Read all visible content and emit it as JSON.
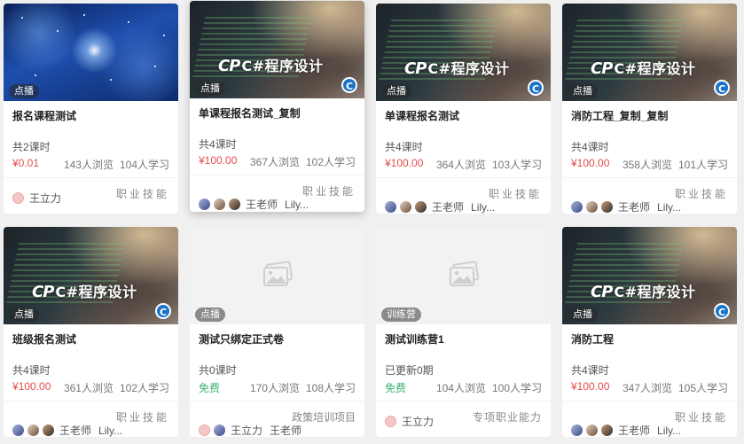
{
  "cards": [
    {
      "tag": "点播",
      "thumb": "galaxy",
      "title": "报名课程测试",
      "lessons": "共2课时",
      "price": "¥0.01",
      "views": "143人浏览",
      "learners": "104人学习",
      "category": "职业技能",
      "teachers": [
        "王立力"
      ]
    },
    {
      "tag": "点播",
      "thumb": "csharp",
      "logo_text": "C#程序设计",
      "title": "单课程报名测试_复制",
      "lessons": "共4课时",
      "price": "¥100.00",
      "views": "367人浏览",
      "learners": "102人学习",
      "category": "职业技能",
      "teachers": [
        "王老师",
        "Lily..."
      ]
    },
    {
      "tag": "点播",
      "thumb": "csharp",
      "logo_text": "C#程序设计",
      "title": "单课程报名测试",
      "lessons": "共4课时",
      "price": "¥100.00",
      "views": "364人浏览",
      "learners": "103人学习",
      "category": "职业技能",
      "teachers": [
        "王老师",
        "Lily..."
      ]
    },
    {
      "tag": "点播",
      "thumb": "csharp",
      "logo_text": "C#程序设计",
      "title": "消防工程_复制_复制",
      "lessons": "共4课时",
      "price": "¥100.00",
      "views": "358人浏览",
      "learners": "101人学习",
      "category": "职业技能",
      "teachers": [
        "王老师",
        "Lily..."
      ]
    },
    {
      "tag": "点播",
      "thumb": "csharp",
      "logo_text": "C#程序设计",
      "title": "班级报名测试",
      "lessons": "共4课时",
      "price": "¥100.00",
      "views": "361人浏览",
      "learners": "102人学习",
      "category": "职业技能",
      "teachers": [
        "王老师",
        "Lily..."
      ]
    },
    {
      "tag": "点播",
      "thumb": "placeholder",
      "title": "测试只绑定正式卷",
      "lessons": "共0课时",
      "price": "免费",
      "views": "170人浏览",
      "learners": "108人学习",
      "category": "政策培训项目",
      "teachers": [
        "王立力",
        "王老师"
      ]
    },
    {
      "tag": "训练营",
      "thumb": "placeholder",
      "title": "测试训练营1",
      "lessons": "已更新0期",
      "price": "免费",
      "views": "104人浏览",
      "learners": "100人学习",
      "category": "专项职业能力",
      "teachers": [
        "王立力"
      ]
    },
    {
      "tag": "点播",
      "thumb": "csharp",
      "logo_text": "C#程序设计",
      "title": "消防工程",
      "lessons": "共4课时",
      "price": "¥100.00",
      "views": "347人浏览",
      "learners": "105人学习",
      "category": "职业技能",
      "teachers": [
        "王老师",
        "Lily..."
      ]
    }
  ],
  "colors": {
    "price": "#e54b4b",
    "free": "#3bb273",
    "tag_bg": "#8a8a8a",
    "accent": "#1a73c9"
  }
}
